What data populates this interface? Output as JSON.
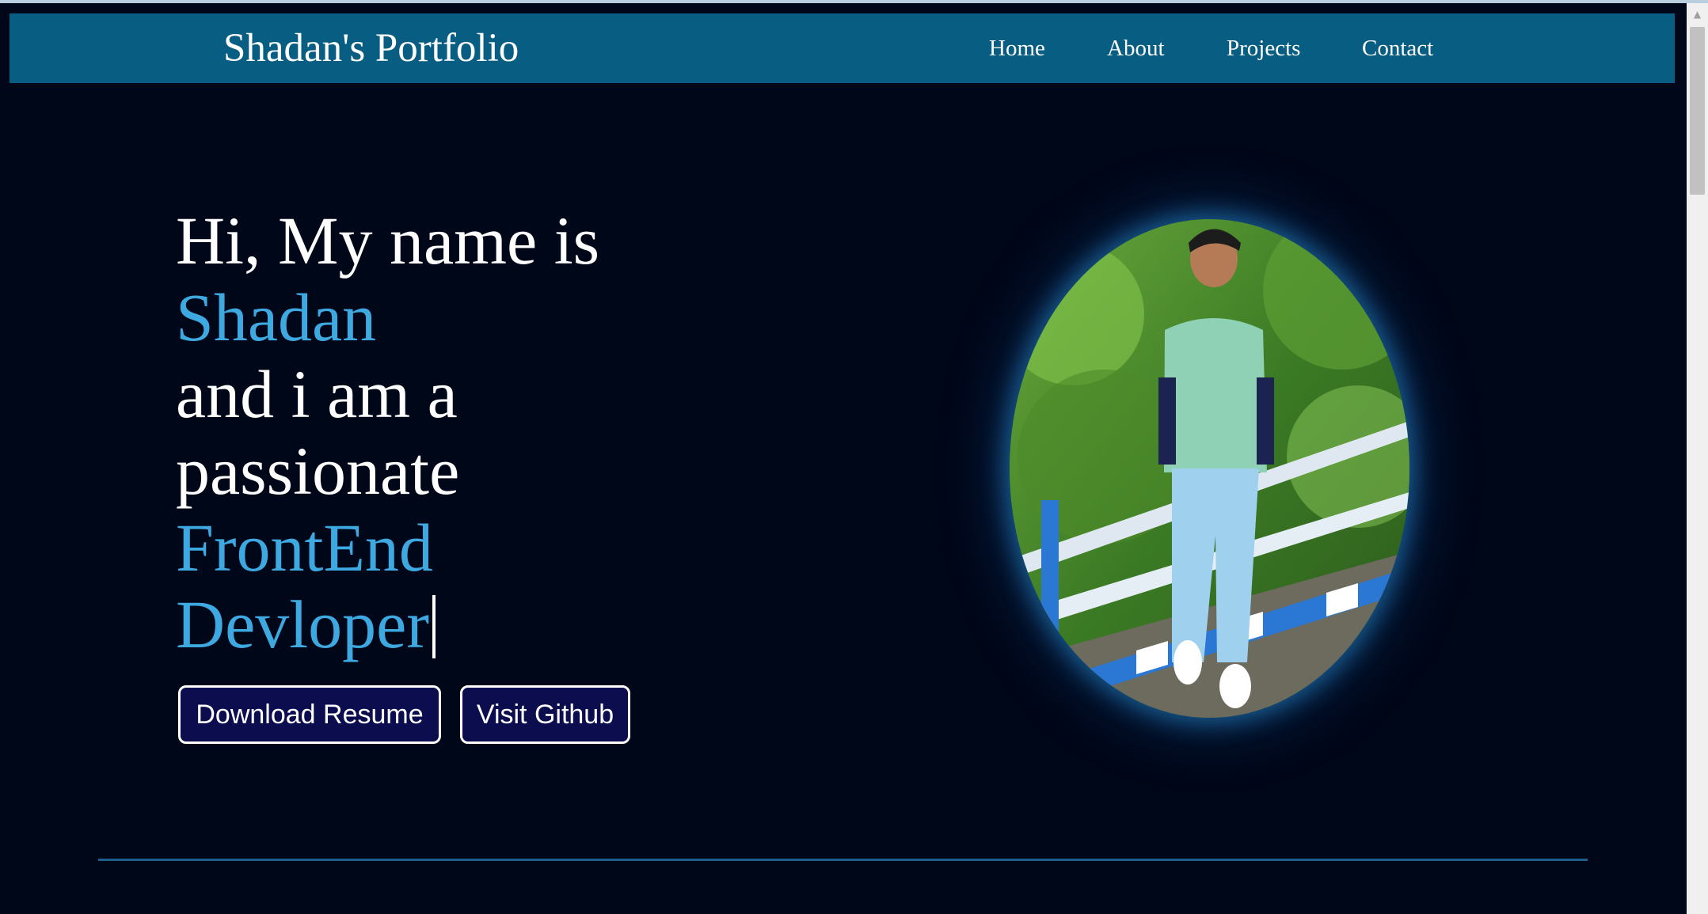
{
  "nav": {
    "brand": "Shadan's Portfolio",
    "links": [
      "Home",
      "About",
      "Projects",
      "Contact"
    ]
  },
  "hero": {
    "line1": "Hi, My name is",
    "name": "Shadan",
    "line3": "and i am a",
    "line4": "passionate",
    "role_line1": "FrontEnd",
    "role_line2": "Devloper"
  },
  "buttons": {
    "resume": "Download Resume",
    "github": "Visit Github"
  },
  "colors": {
    "page_background": "#000719",
    "navbar": "#085d82",
    "accent": "#3ea8e0",
    "button_background": "#0b0d4e"
  },
  "icons": {
    "scroll_up": "scroll-up-arrow-icon"
  }
}
